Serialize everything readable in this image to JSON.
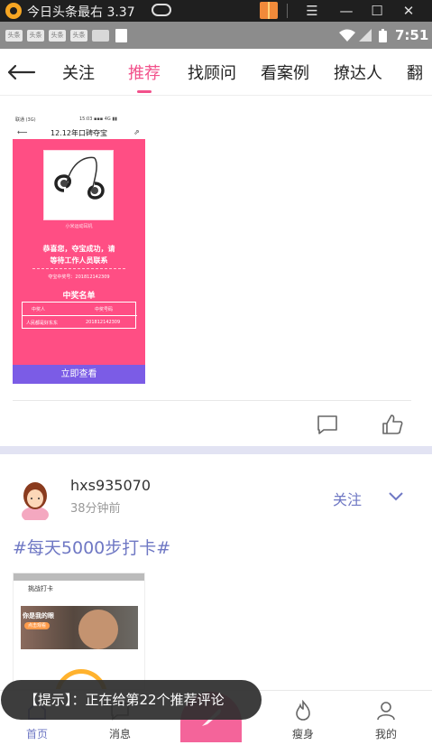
{
  "emulator": {
    "title": "今日头条最右 3.37",
    "controls": [
      "menu-icon",
      "minimize-icon",
      "maximize-icon",
      "close-icon"
    ]
  },
  "status_bar": {
    "notifications": [
      "头条",
      "头条",
      "头条",
      "头条"
    ],
    "time": "7:51"
  },
  "nav": {
    "tabs": [
      {
        "label": "关注",
        "active": false
      },
      {
        "label": "推荐",
        "active": true
      },
      {
        "label": "找顾问",
        "active": false
      },
      {
        "label": "看案例",
        "active": false
      },
      {
        "label": "撩达人",
        "active": false
      },
      {
        "label": "翻",
        "active": false
      }
    ],
    "accent_color": "#f2518b"
  },
  "post1": {
    "image": {
      "status_left": "联通 (3G)",
      "status_right": "15:03 ▪▪▪ 4G ▮▮",
      "title": "12.12年口碑夺宝",
      "product_name": "小米运动耳机",
      "congrats_line1": "恭喜您，夺宝成功，请",
      "congrats_line2": "等待工作人员联系",
      "ref": "夺宝中奖号：201812142309",
      "winners_title": "中奖名单",
      "table_header": [
        "中奖人",
        "中奖号码"
      ],
      "table_row": [
        "人民都是好东东",
        "201812142309"
      ],
      "button": "立即查看"
    }
  },
  "post2": {
    "username": "hxs935070",
    "time": "38分钟前",
    "follow": "关注",
    "hashtag": "#每天5000步打卡#",
    "image": {
      "title": "挑战打卡",
      "caption": "你是我的眼",
      "chip": "点击观看"
    }
  },
  "toast": {
    "text": "【提示】：正在给第22个推荐评论"
  },
  "bottom_nav": {
    "items": [
      {
        "label": "首页",
        "icon": "home-icon",
        "active": true
      },
      {
        "label": "消息",
        "icon": "message-icon",
        "active": false
      },
      {
        "label": "瘦身",
        "icon": "flame-icon",
        "active": false
      },
      {
        "label": "我的",
        "icon": "profile-icon",
        "active": false
      }
    ],
    "center_icon": "feather-pen-icon",
    "active_color": "#6f78c4",
    "center_color": "#f4649a"
  }
}
